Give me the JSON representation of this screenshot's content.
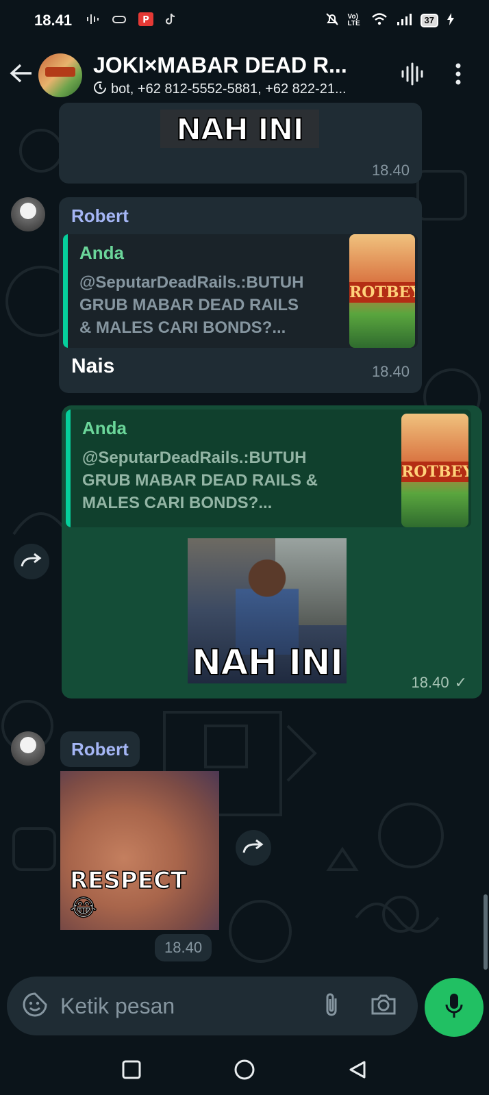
{
  "status_bar": {
    "time": "18.41",
    "volte": "Vo) LTE",
    "battery": "37"
  },
  "header": {
    "title": "JOKI×MABAR DEAD R...",
    "subtitle": "bot, +62 812-5552-5881, +62 822-21..."
  },
  "messages": {
    "m1": {
      "caption": "NAH INI",
      "time": "18.40"
    },
    "m2": {
      "sender": "Robert",
      "quote_name": "Anda",
      "quote_lines": [
        "@SeputarDeadRails.:BUTUH",
        "GRUB MABAR DEAD RAILS",
        "& MALES CARI BONDS?..."
      ],
      "thumb_text": "ROTBEY",
      "text": "Nais",
      "time": "18.40"
    },
    "m3": {
      "quote_name": "Anda",
      "quote_lines": [
        "@SeputarDeadRails.:BUTUH",
        "GRUB MABAR DEAD RAILS &",
        "MALES CARI BONDS?..."
      ],
      "thumb_text": "ROTBEY",
      "caption": "NAH INI",
      "time": "18.40",
      "status": "✓"
    },
    "m4": {
      "sender": "Robert",
      "caption": "RESPECT 😂",
      "time": "18.40"
    }
  },
  "composer": {
    "placeholder": "Ketik pesan"
  },
  "colors": {
    "background": "#0b141a",
    "incoming": "#1f2c34",
    "outgoing": "#144d37",
    "accent": "#21c063",
    "sender_name": "#a5b6f5",
    "quote_name": "#6bd69a"
  }
}
